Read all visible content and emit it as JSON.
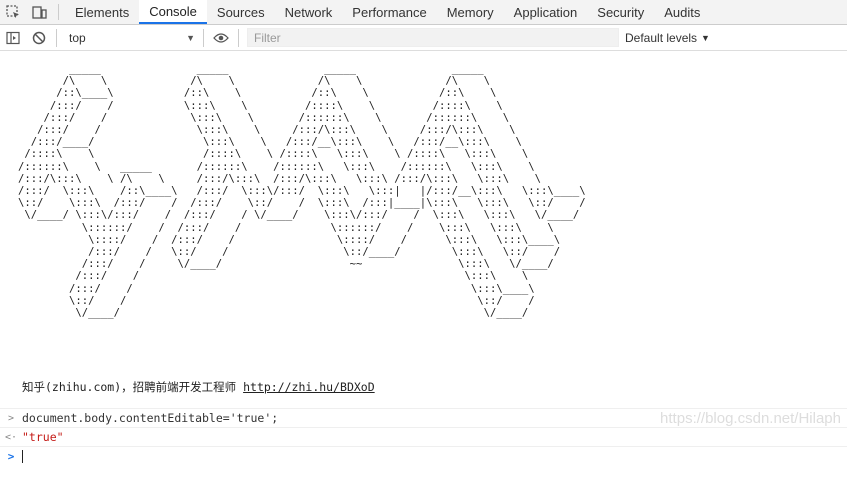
{
  "tabbar": {
    "icons": [
      "inspect-icon",
      "device-icon"
    ],
    "tabs": [
      {
        "label": "Elements"
      },
      {
        "label": "Console"
      },
      {
        "label": "Sources"
      },
      {
        "label": "Network"
      },
      {
        "label": "Performance"
      },
      {
        "label": "Memory"
      },
      {
        "label": "Application"
      },
      {
        "label": "Security"
      },
      {
        "label": "Audits"
      }
    ],
    "active_tab": "Console"
  },
  "toolbar": {
    "context": "top",
    "filter_placeholder": "Filter",
    "levels_label": "Default levels"
  },
  "console": {
    "ascii_art": "        _____               _____               _____               _____\n       /\\    \\             /\\    \\             /\\    \\             /\\    \\\n      /::\\____\\           /::\\    \\           /::\\    \\           /::\\    \\\n     /:::/    /           \\:::\\    \\         /::::\\    \\         /::::\\    \\\n    /:::/    /             \\:::\\    \\       /::::::\\    \\       /::::::\\    \\\n   /:::/    /               \\:::\\    \\     /:::/\\:::\\    \\     /:::/\\:::\\    \\\n  /:::/____/                 \\:::\\    \\   /:::/__\\:::\\    \\   /:::/__\\:::\\    \\\n /::::\\    \\                 /::::\\    \\ /::::\\   \\:::\\    \\ /::::\\   \\:::\\    \\\n/::::::\\    \\   _____       /::::::\\    /::::::\\   \\:::\\    /::::::\\   \\:::\\    \\\n/:::/\\:::\\    \\ /\\    \\     /:::/\\:::\\  /:::/\\:::\\   \\:::\\ /:::/\\:::\\   \\:::\\    \\\n/:::/  \\:::\\    /::\\____\\   /:::/  \\:::\\/:::/  \\:::\\   \\:::|   |/:::/__\\:::\\   \\:::\\____\\\n\\::/    \\:::\\  /:::/    /  /:::/    \\::/    /  \\:::\\  /:::|____|\\:::\\   \\:::\\   \\::/    /\n \\/____/ \\:::\\/:::/    /  /:::/    / \\/____/    \\:::\\/:::/    /  \\:::\\   \\:::\\   \\/____/\n          \\::::::/    /  /:::/    /              \\::::::/    /    \\:::\\   \\:::\\    \\\n           \\::::/    /  /:::/    /                \\::::/    /      \\:::\\   \\:::\\____\\\n           /:::/    /   \\::/    /                  \\::/____/        \\:::\\   \\::/    /\n          /:::/    /     \\/____/                    ~~               \\:::\\   \\/____/\n         /:::/    /                                                   \\:::\\    \\\n        /:::/    /                                                     \\:::\\____\\\n        \\::/    /                                                       \\::/    /\n         \\/____/                                                         \\/____/",
    "message_text": "知乎(zhihu.com)，招聘前端开发工程师 ",
    "message_link": "http://zhi.hu/BDXoD",
    "command": "document.body.contentEditable='true';",
    "result": "\"true\"",
    "prompt_value": ""
  },
  "watermark": "https://blog.csdn.net/Hilaph",
  "colors": {
    "accent": "#1a73e8",
    "string": "#c41a16"
  }
}
